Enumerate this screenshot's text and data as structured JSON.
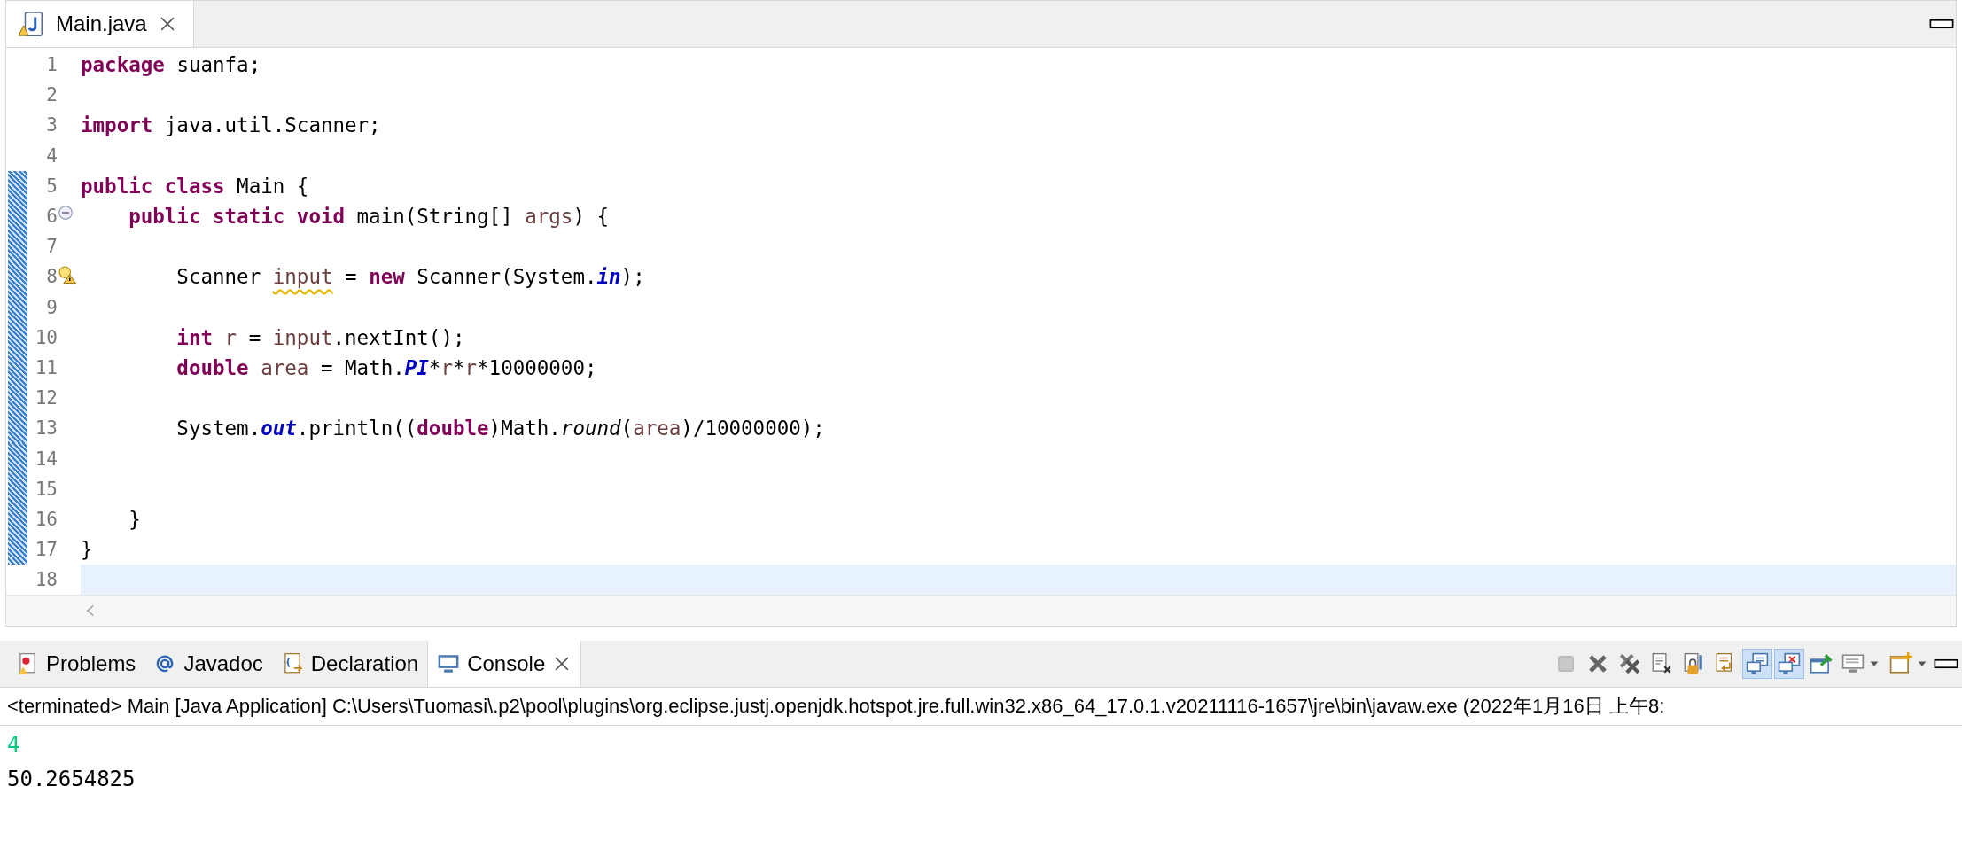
{
  "editor_tab": {
    "title": "Main.java",
    "selected": true,
    "warning": true
  },
  "code_lines": [
    {
      "number": "1",
      "changed": false,
      "current": false,
      "kind": "plain",
      "tokens": [
        {
          "t": "package ",
          "kind": "keyword"
        },
        {
          "t": "suanfa;",
          "kind": "plain"
        }
      ]
    },
    {
      "number": "2",
      "changed": false,
      "current": false,
      "kind": "plain"
    },
    {
      "number": "3",
      "changed": false,
      "current": false,
      "kind": "plain",
      "tokens": [
        {
          "t": "import ",
          "kind": "keyword"
        },
        {
          "t": "java.util.Scanner;",
          "kind": "plain"
        }
      ]
    },
    {
      "number": "4",
      "changed": false,
      "current": false,
      "kind": "plain"
    },
    {
      "number": "5",
      "changed": true,
      "current": false,
      "kind": "plain",
      "tokens": [
        {
          "t": "public class ",
          "kind": "keyword"
        },
        {
          "t": "Main {",
          "kind": "plain"
        }
      ]
    },
    {
      "number": "6",
      "changed": true,
      "current": false,
      "kind": "fold",
      "tokens": [
        {
          "t": "    public static void ",
          "kind": "keyword"
        },
        {
          "t": "main(String[] ",
          "kind": "plain"
        },
        {
          "t": "args",
          "kind": "local"
        },
        {
          "t": ") {",
          "kind": "plain"
        }
      ]
    },
    {
      "number": "7",
      "changed": true,
      "current": false,
      "kind": "plain"
    },
    {
      "number": "8",
      "changed": true,
      "current": false,
      "kind": "warning",
      "tokens": [
        {
          "t": "        Scanner ",
          "kind": "plain"
        },
        {
          "t": "input",
          "kind": "warned"
        },
        {
          "t": " = ",
          "kind": "plain"
        },
        {
          "t": "new ",
          "kind": "keyword"
        },
        {
          "t": "Scanner(System.",
          "kind": "plain"
        },
        {
          "t": "in",
          "kind": "static-field"
        },
        {
          "t": ");",
          "kind": "plain"
        }
      ]
    },
    {
      "number": "9",
      "changed": true,
      "current": false,
      "kind": "plain"
    },
    {
      "number": "10",
      "changed": true,
      "current": false,
      "kind": "plain",
      "tokens": [
        {
          "t": "        int ",
          "kind": "keyword"
        },
        {
          "t": "r",
          "kind": "local"
        },
        {
          "t": " = ",
          "kind": "plain"
        },
        {
          "t": "input",
          "kind": "local"
        },
        {
          "t": ".nextInt();",
          "kind": "plain"
        }
      ]
    },
    {
      "number": "11",
      "changed": true,
      "current": false,
      "kind": "plain",
      "tokens": [
        {
          "t": "        double ",
          "kind": "keyword"
        },
        {
          "t": "area",
          "kind": "local"
        },
        {
          "t": " = Math.",
          "kind": "plain"
        },
        {
          "t": "PI",
          "kind": "static-field"
        },
        {
          "t": "*",
          "kind": "plain"
        },
        {
          "t": "r",
          "kind": "local"
        },
        {
          "t": "*",
          "kind": "plain"
        },
        {
          "t": "r",
          "kind": "local"
        },
        {
          "t": "*10000000;",
          "kind": "plain"
        }
      ]
    },
    {
      "number": "12",
      "changed": true,
      "current": false,
      "kind": "plain"
    },
    {
      "number": "13",
      "changed": true,
      "current": false,
      "kind": "plain",
      "tokens": [
        {
          "t": "        System.",
          "kind": "plain"
        },
        {
          "t": "out",
          "kind": "static-field"
        },
        {
          "t": ".println((",
          "kind": "plain"
        },
        {
          "t": "double",
          "kind": "keyword"
        },
        {
          "t": ")Math.",
          "kind": "plain"
        },
        {
          "t": "round",
          "kind": "static-method"
        },
        {
          "t": "(",
          "kind": "plain"
        },
        {
          "t": "area",
          "kind": "local"
        },
        {
          "t": ")/10000000);",
          "kind": "plain"
        }
      ]
    },
    {
      "number": "14",
      "changed": true,
      "current": false,
      "kind": "plain"
    },
    {
      "number": "15",
      "changed": true,
      "current": false,
      "kind": "plain"
    },
    {
      "number": "16",
      "changed": true,
      "current": false,
      "kind": "plain",
      "tokens": [
        {
          "t": "    }",
          "kind": "plain"
        }
      ]
    },
    {
      "number": "17",
      "changed": true,
      "current": false,
      "kind": "plain",
      "tokens": [
        {
          "t": "}",
          "kind": "plain"
        }
      ]
    },
    {
      "number": "18",
      "changed": false,
      "current": true,
      "kind": "plain"
    }
  ],
  "panel_tabs": [
    {
      "label": "Problems",
      "selected": false,
      "closable": false
    },
    {
      "label": "Javadoc",
      "selected": false,
      "closable": false
    },
    {
      "label": "Declaration",
      "selected": false,
      "closable": false
    },
    {
      "label": "Console",
      "selected": true,
      "closable": true
    }
  ],
  "console_toolbar": [
    {
      "kind": "terminate",
      "disabled": true,
      "pressed": false,
      "dropdown": false
    },
    {
      "kind": "remove-launch",
      "disabled": false,
      "pressed": false,
      "dropdown": false
    },
    {
      "kind": "remove-all",
      "disabled": false,
      "pressed": false,
      "dropdown": false
    },
    {
      "kind": "clear",
      "disabled": false,
      "pressed": false,
      "dropdown": false
    },
    {
      "kind": "scroll-lock",
      "disabled": false,
      "pressed": false,
      "dropdown": false
    },
    {
      "kind": "word-wrap",
      "disabled": false,
      "pressed": false,
      "dropdown": false
    },
    {
      "kind": "show-stdout",
      "disabled": false,
      "pressed": true,
      "dropdown": false
    },
    {
      "kind": "show-stderr",
      "disabled": false,
      "pressed": true,
      "dropdown": false
    },
    {
      "kind": "pin",
      "disabled": false,
      "pressed": false,
      "dropdown": false
    },
    {
      "kind": "display-console",
      "disabled": false,
      "pressed": false,
      "dropdown": true
    },
    {
      "kind": "open-console",
      "disabled": false,
      "pressed": false,
      "dropdown": true
    }
  ],
  "console": {
    "status": "<terminated> Main [Java Application] C:\\Users\\Tuomasi\\.p2\\pool\\plugins\\org.eclipse.justj.openjdk.hotspot.jre.full.win32.x86_64_17.0.1.v20211116-1657\\jre\\bin\\javaw.exe  (2022年1月16日 上午8:",
    "lines": [
      {
        "text": "4",
        "kind": "input"
      },
      {
        "text": "50.2654825",
        "kind": "output"
      }
    ]
  }
}
